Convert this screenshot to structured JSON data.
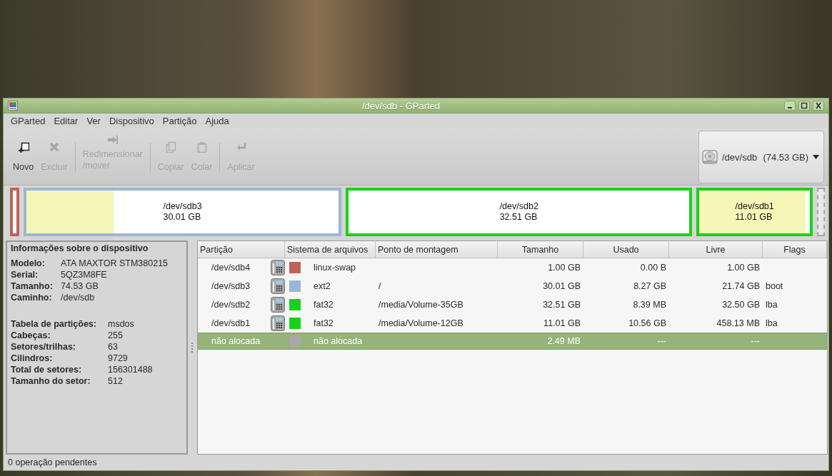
{
  "window": {
    "title": "/dev/sdb - GParted"
  },
  "menu": [
    "GParted",
    "Editar",
    "Ver",
    "Dispositivo",
    "Partição",
    "Ajuda"
  ],
  "toolbar": [
    {
      "kind": "new",
      "label": "Novo",
      "disabled": false
    },
    {
      "kind": "delete",
      "label": "Excluir",
      "disabled": true
    },
    {
      "kind": "resize",
      "label": "Redimensionar\n/mover",
      "disabled": true
    },
    {
      "kind": "copy",
      "label": "Copiar",
      "disabled": true
    },
    {
      "kind": "paste",
      "label": "Colar",
      "disabled": true
    },
    {
      "kind": "apply",
      "label": "Aplicar",
      "disabled": true
    }
  ],
  "device_selector": {
    "device": "/dev/sdb",
    "size": "(74.53 GB)"
  },
  "disk_map": [
    {
      "kind": "partition",
      "color": "#c0625a"
    },
    {
      "kind": "partition",
      "color": "#9ab6d4",
      "level": 0.28,
      "name": "/dev/sdb3",
      "size": "30.01 GB"
    },
    {
      "kind": "partition",
      "color": "#17d417",
      "level": 0,
      "name": "/dev/sdb2",
      "size": "32.51 GB"
    },
    {
      "kind": "partition",
      "color": "#17d417",
      "level": 0.96,
      "name": "/dev/sdb1",
      "size": "11.01 GB"
    },
    {
      "kind": "unallocated",
      "color": "#a8a8a8"
    }
  ],
  "device_info": {
    "title": "Informações sobre o dispositivo",
    "details": [
      {
        "label": "Modelo:",
        "value": "ATA MAXTOR STM380215"
      },
      {
        "label": "Serial:",
        "value": "5QZ3M8FE"
      },
      {
        "label": "Tamanho:",
        "value": "74.53 GB"
      },
      {
        "label": "Caminho:",
        "value": "/dev/sdb"
      }
    ],
    "geometry": [
      {
        "label": "Tabela de partições:",
        "value": "msdos"
      },
      {
        "label": "Cabeças:",
        "value": "255"
      },
      {
        "label": "Setores/trilhas:",
        "value": "63"
      },
      {
        "label": "Cilindros:",
        "value": "9729"
      },
      {
        "label": "Total de setores:",
        "value": "156301488"
      },
      {
        "label": "Tamanho do setor:",
        "value": "512"
      }
    ]
  },
  "table": {
    "columns": [
      "Partição",
      "Sistema de arquivos",
      "Ponto de montagem",
      "Tamanho",
      "Usado",
      "Livre",
      "Flags"
    ],
    "rows": [
      {
        "kind": "partition",
        "partition": "/dev/sdb4",
        "color": "#c0625a",
        "filesystem": "linux-swap",
        "mount": "",
        "size": "1.00 GB",
        "used": "0.00 B",
        "free": "1.00 GB",
        "flags": "",
        "selected": false
      },
      {
        "kind": "partition",
        "partition": "/dev/sdb3",
        "color": "#9ab6d4",
        "filesystem": "ext2",
        "mount": "/",
        "size": "30.01 GB",
        "used": "8.27 GB",
        "free": "21.74 GB",
        "flags": "boot",
        "selected": false
      },
      {
        "kind": "partition",
        "partition": "/dev/sdb2",
        "color": "#17d417",
        "filesystem": "fat32",
        "mount": "/media/Volume-35GB",
        "size": "32.51 GB",
        "used": "8.39 MB",
        "free": "32.50 GB",
        "flags": "lba",
        "selected": false
      },
      {
        "kind": "partition",
        "partition": "/dev/sdb1",
        "color": "#17d417",
        "filesystem": "fat32",
        "mount": "/media/Volume-12GB",
        "size": "11.01 GB",
        "used": "10.56 GB",
        "free": "458.13 MB",
        "flags": "lba",
        "selected": false
      },
      {
        "kind": "unallocated",
        "partition": "não alocada",
        "color": "#a8a8a8",
        "filesystem": "não alocada",
        "mount": "",
        "size": "2.49 MB",
        "used": "---",
        "free": "---",
        "flags": "",
        "selected": true
      }
    ]
  },
  "status_bar": "0 operação pendentes"
}
